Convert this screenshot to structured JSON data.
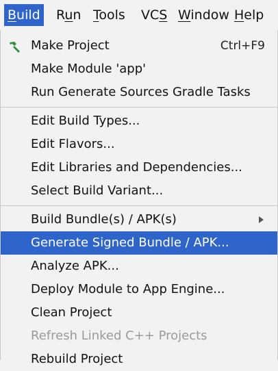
{
  "menubar": {
    "items": [
      {
        "label": "Build",
        "active": true
      },
      {
        "label": "Run"
      },
      {
        "label": "Tools"
      },
      {
        "label": "VCS"
      },
      {
        "label": "Window"
      },
      {
        "label": "Help"
      }
    ]
  },
  "dropdown": {
    "items": [
      {
        "label": "Make Project",
        "shortcut": "Ctrl+F9",
        "icon": "hammer-icon"
      },
      {
        "label": "Make Module 'app'"
      },
      {
        "label": "Run Generate Sources Gradle Tasks"
      },
      {
        "label": "Edit Build Types..."
      },
      {
        "label": "Edit Flavors..."
      },
      {
        "label": "Edit Libraries and Dependencies..."
      },
      {
        "label": "Select Build Variant..."
      },
      {
        "label": "Build Bundle(s) / APK(s)",
        "submenu": true
      },
      {
        "label": "Generate Signed Bundle / APK...",
        "selected": true
      },
      {
        "label": "Analyze APK..."
      },
      {
        "label": "Deploy Module to App Engine..."
      },
      {
        "label": "Clean Project"
      },
      {
        "label": "Refresh Linked C++ Projects",
        "disabled": true
      },
      {
        "label": "Rebuild Project"
      }
    ]
  },
  "colors": {
    "selection": "#2f65ca",
    "background": "#f2f2f2",
    "disabled_text": "#9a9a9a",
    "hammer_icon": "#2f8f3a"
  }
}
